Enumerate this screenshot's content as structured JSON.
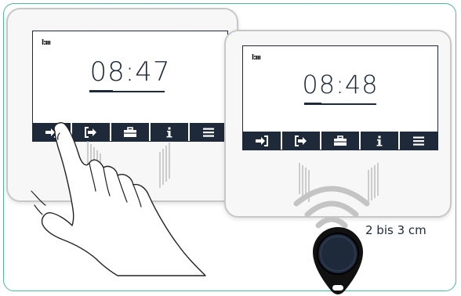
{
  "left_terminal": {
    "status_icon": "l:ııı",
    "time": "08:47",
    "buttons": [
      {
        "icon": "enter-arrow-icon",
        "glyph": "➜"
      },
      {
        "icon": "exit-arrow-icon",
        "glyph": "➜"
      },
      {
        "icon": "briefcase-icon",
        "glyph": "▣"
      },
      {
        "icon": "info-icon",
        "glyph": "i"
      },
      {
        "icon": "menu-icon",
        "glyph": "☰"
      }
    ]
  },
  "right_terminal": {
    "status_icon": "l:ııı",
    "time": "08:48",
    "buttons": [
      {
        "icon": "enter-arrow-icon",
        "glyph": "➜"
      },
      {
        "icon": "exit-arrow-icon",
        "glyph": "➜"
      },
      {
        "icon": "briefcase-icon",
        "glyph": "▣"
      },
      {
        "icon": "info-icon",
        "glyph": "i"
      },
      {
        "icon": "menu-icon",
        "glyph": "☰"
      }
    ]
  },
  "distance_label": "2 bis 3 cm",
  "colors": {
    "frame": "#4db89e",
    "screen_dark": "#1e2a3a",
    "terminal_border": "#c7c7c7"
  }
}
